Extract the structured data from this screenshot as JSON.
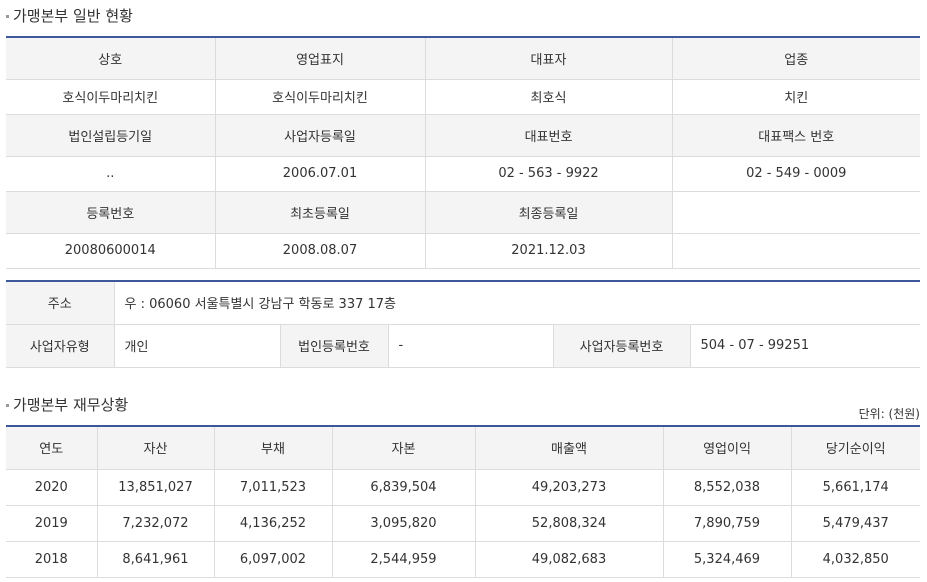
{
  "general": {
    "title": "가맹본부 일반 현황",
    "row1_headers": [
      "상호",
      "영업표지",
      "대표자",
      "업종"
    ],
    "row1_values": [
      "호식이두마리치킨",
      "호식이두마리치킨",
      "최호식",
      "치킨"
    ],
    "row2_headers": [
      "법인설립등기일",
      "사업자등록일",
      "대표번호",
      "대표팩스 번호"
    ],
    "row2_values": [
      "..",
      "2006.07.01",
      "02 - 563 - 9922",
      "02 - 549 - 0009"
    ],
    "row3_headers": [
      "등록번호",
      "최초등록일",
      "최종등록일"
    ],
    "row3_values": [
      "20080600014",
      "2008.08.07",
      "2021.12.03"
    ]
  },
  "address": {
    "address_label": "주소",
    "address_value": "우 : 06060 서울특별시 강남구 학동로 337 17층",
    "biz_type_label": "사업자유형",
    "biz_type_value": "개인",
    "corp_no_label": "법인등록번호",
    "corp_no_value": "-",
    "biz_no_label": "사업자등록번호",
    "biz_no_value": "504 - 07 - 99251"
  },
  "finance": {
    "title": "가맹본부 재무상황",
    "unit": "단위: (천원)",
    "headers": [
      "연도",
      "자산",
      "부채",
      "자본",
      "매출액",
      "영업이익",
      "당기순이익"
    ],
    "rows": [
      [
        "2020",
        "13,851,027",
        "7,011,523",
        "6,839,504",
        "49,203,273",
        "8,552,038",
        "5,661,174"
      ],
      [
        "2019",
        "7,232,072",
        "4,136,252",
        "3,095,820",
        "52,808,324",
        "7,890,759",
        "5,479,437"
      ],
      [
        "2018",
        "8,641,961",
        "6,097,002",
        "2,544,959",
        "49,082,683",
        "5,324,469",
        "4,032,850"
      ]
    ]
  }
}
